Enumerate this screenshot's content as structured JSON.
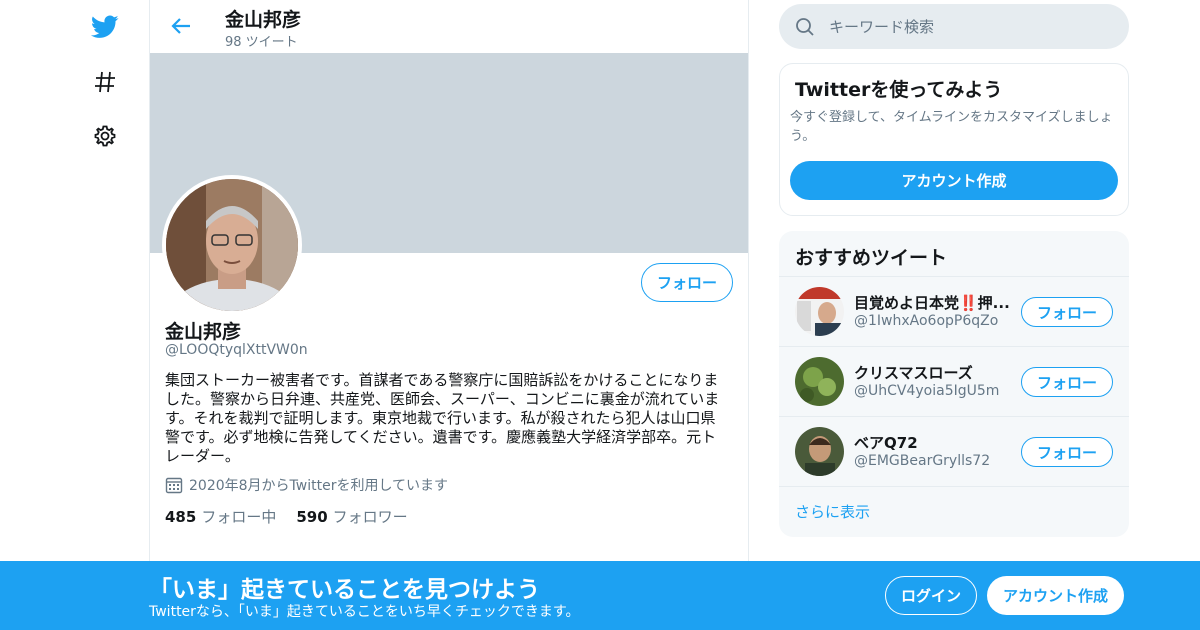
{
  "colors": {
    "accent": "#1da1f2",
    "banner": "#ccd6dd",
    "muted": "#657786",
    "card_bg": "#f5f8fa",
    "border": "#e6ecf0"
  },
  "nav": {
    "icons": [
      "twitter-bird-icon",
      "hashtag-icon",
      "gear-icon"
    ]
  },
  "header": {
    "name": "金山邦彦",
    "tweet_count": "98 ツイート"
  },
  "profile": {
    "name": "金山邦彦",
    "handle": "@LOOQtyqlXttVW0n",
    "follow_label": "フォロー",
    "bio": "集団ストーカー被害者です。首謀者である警察庁に国賠訴訟をかけることになりました。警察から日弁連、共産党、医師会、スーパー、コンビニに裏金が流れています。それを裁判で証明します。東京地裁で行います。私が殺されたら犯人は山口県警です。必ず地検に告発してください。遺書です。慶應義塾大学経済学部卒。元トレーダー。",
    "joined": "2020年8月からTwitterを利用しています",
    "following_count": "485",
    "following_label": "フォロー中",
    "followers_count": "590",
    "followers_label": "フォロワー"
  },
  "search": {
    "placeholder": "キーワード検索"
  },
  "signup_card": {
    "title": "Twitterを使ってみよう",
    "description": "今すぐ登録して、タイムラインをカスタマイズしましょう。",
    "button": "アカウント作成"
  },
  "recommended": {
    "title": "おすすめツイート",
    "items": [
      {
        "name": "目覚めよ日本党‼️押...",
        "handle": "@1IwhxAo6opP6qZo",
        "follow_label": "フォロー"
      },
      {
        "name": "クリスマスローズ",
        "handle": "@UhCV4yoia5IgU5m",
        "follow_label": "フォロー"
      },
      {
        "name": "ベアQ72",
        "handle": "@EMGBearGrylls72",
        "follow_label": "フォロー"
      }
    ],
    "more": "さらに表示"
  },
  "bottom_bar": {
    "title": "「いま」起きていることを見つけよう",
    "subtitle": "Twitterなら、「いま」起きていることをいち早くチェックできます。",
    "login": "ログイン",
    "signup": "アカウント作成"
  }
}
